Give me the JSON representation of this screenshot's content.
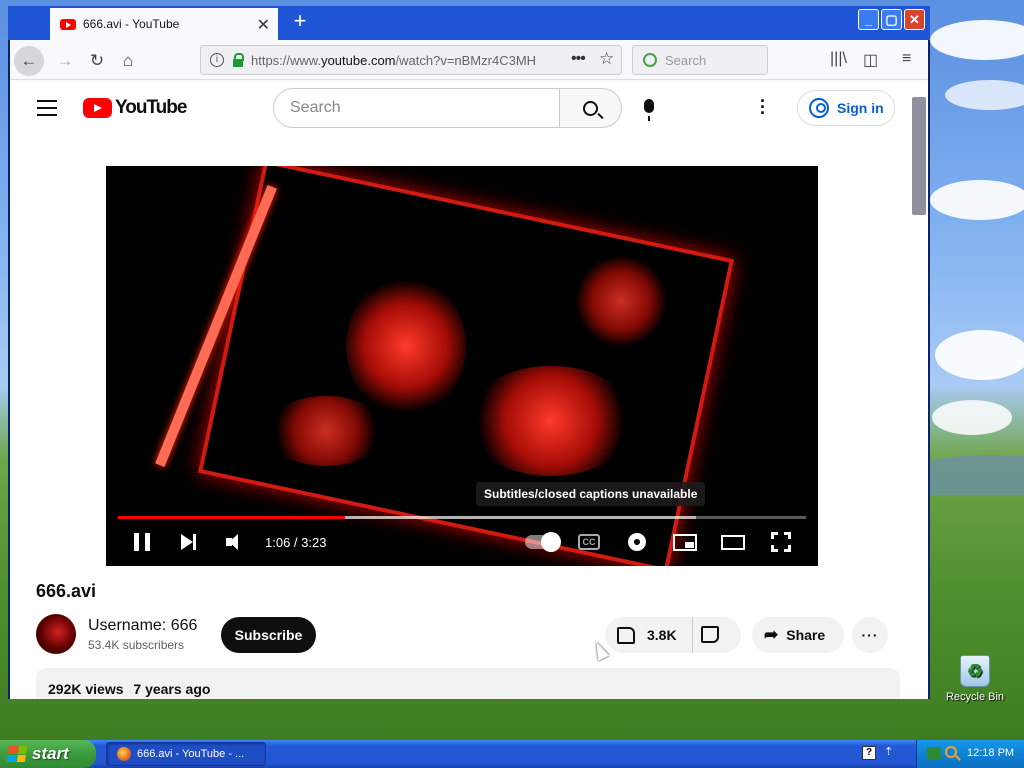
{
  "browser": {
    "tab_title": "666.avi - YouTube",
    "tab_close": "✕",
    "new_tab": "+",
    "url_prefix": "https://www.",
    "url_domain": "youtube.com",
    "url_path": "/watch?v=nBMzr4C3MH",
    "search_placeholder": "Search"
  },
  "youtube": {
    "logo_text": "YouTube",
    "search_placeholder": "Search",
    "sign_in": "Sign in",
    "player": {
      "tooltip": "Subtitles/closed captions unavailable",
      "time": "1:06 / 3:23",
      "cc_label": "CC",
      "progress_fraction": 0.33,
      "buffered_fraction": 0.84
    },
    "video_title": "666.avi",
    "channel_name": "Username: 666",
    "subscribers": "53.4K subscribers",
    "subscribe": "Subscribe",
    "likes": "3.8K",
    "share": "Share",
    "more": "···",
    "views": "292K views",
    "age": "7 years ago"
  },
  "desktop": {
    "recycle_bin": "Recycle Bin"
  },
  "taskbar": {
    "start": "start",
    "window_button": "666.avi - YouTube - ...",
    "clock": "12:18 PM"
  },
  "colors": {
    "youtube_red": "#ff0000",
    "xp_blue": "#245edb",
    "start_green": "#3a9b3c",
    "link_blue": "#065fd4"
  }
}
